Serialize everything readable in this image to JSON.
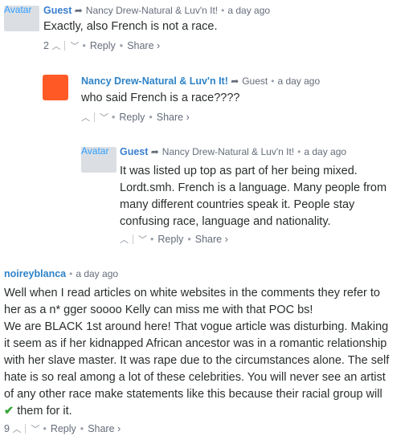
{
  "comments": [
    {
      "avatar_alt": "Avatar",
      "author": "Guest",
      "reply_to": "Nancy Drew-Natural & Luv'n It!",
      "time": "a day ago",
      "text": "Exactly, also French is not a race.",
      "votes": "2",
      "reply": "Reply",
      "share": "Share ›"
    },
    {
      "author": "Nancy Drew-Natural & Luv'n It!",
      "reply_to": "Guest",
      "time": "a day ago",
      "text": "who said French is a race????",
      "votes": "",
      "reply": "Reply",
      "share": "Share ›",
      "avatar_color": "#ff5a26"
    },
    {
      "avatar_alt": "Avatar",
      "author": "Guest",
      "reply_to": "Nancy Drew-Natural & Luv'n It!",
      "time": "a day ago",
      "lines": [
        "It was listed up top as part of her being mixed.",
        "Lordt.smh. French is a language. Many people from",
        "many different countries speak it. People stay",
        "confusing race, language and nationality."
      ],
      "votes": "",
      "reply": "Reply",
      "share": "Share ›"
    },
    {
      "author": "noireyblanca",
      "time": "a day ago",
      "lines": [
        "Well when I read articles on white websites in the comments they refer to",
        "her as a n* gger soooo Kelly can miss me with that POC bs!",
        "We are BLACK 1st around here! That vogue article was disturbing. Making",
        "it seem as if her kidnapped African ancestor was in a romantic relationship",
        "with her slave master. It was rape due to the circumstances alone. The self",
        "hate is so real among a lot of these celebrities. You will never see an artist",
        "of any other race make statements like this because their racial group will",
        "them for it."
      ],
      "votes": "9",
      "reply": "Reply",
      "share": "Share ›"
    }
  ],
  "colors": {
    "author": "#2e83c8",
    "check": "#3aa53a",
    "orange_avatar": "#ff5a26"
  }
}
